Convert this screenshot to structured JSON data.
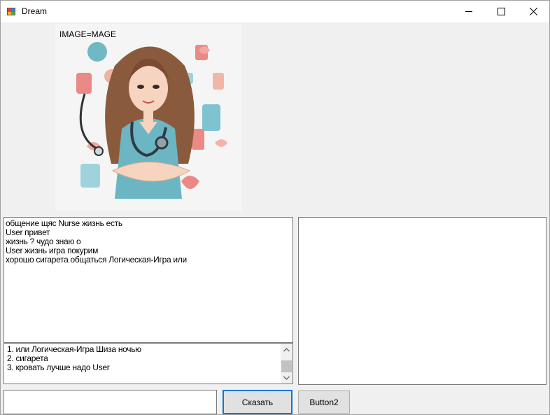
{
  "window": {
    "title": "Dream"
  },
  "picture": {
    "label": "IMAGE=MAGE"
  },
  "chat": {
    "lines": [
      "общение щяс Nurse жизнь есть",
      "User привет",
      "жизнь ? чудо знаю о",
      "User жизнь игра покурим",
      "хорошо сигарета общаться Логическая-Игра или"
    ]
  },
  "options": {
    "items": [
      "1. или Логическая-Игра Шиза ночью",
      "2. сигарета",
      "3. кровать лучше надо User"
    ]
  },
  "input": {
    "value": ""
  },
  "buttons": {
    "say_label": "Сказать",
    "button2_label": "Button2"
  },
  "colors": {
    "accent": "#0078d7",
    "border": "#7a7a7a",
    "background": "#f0f0f0"
  }
}
